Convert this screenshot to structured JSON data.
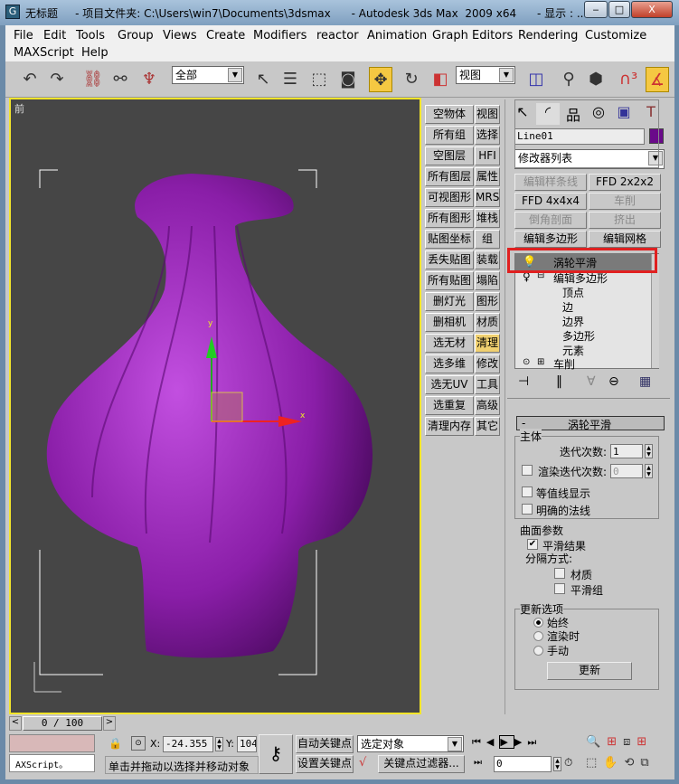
{
  "titlebar": {
    "text": "无标题     - 项目文件夹: C:\\Users\\win7\\Documents\\3dsmax      - Autodesk 3ds Max  2009 x64      - 显示 : ...",
    "app_icon": "3dsmax-logo-icon"
  },
  "menu": [
    "File",
    "Edit",
    "Tools",
    "Group",
    "Views",
    "Create",
    "Modifiers",
    "reactor",
    "Animation",
    "Graph Editors",
    "Rendering",
    "Customize",
    "MAXScript",
    "Help"
  ],
  "toolbar": {
    "selection_filter": "全部",
    "ref_coord": "视图"
  },
  "viewport": {
    "label": "前",
    "axis_y": "y",
    "axis_x": "x",
    "object_color": "#8a1ea8"
  },
  "left_buttons": [
    [
      "空物体",
      "视图"
    ],
    [
      "所有组",
      "选择"
    ],
    [
      "空图层",
      "HFI"
    ],
    [
      "所有图层",
      "属性"
    ],
    [
      "可视图形",
      "MRS"
    ],
    [
      "所有图形",
      "堆栈"
    ],
    [
      "贴图坐标",
      "组"
    ],
    [
      "丢失贴图",
      "装载"
    ],
    [
      "所有贴图",
      "塌陷"
    ],
    [
      "删灯光",
      "图形"
    ],
    [
      "删相机",
      "材质"
    ],
    [
      "选无材",
      "清理"
    ],
    [
      "选多维",
      "修改"
    ],
    [
      "选无UV",
      "工具"
    ],
    [
      "选重复",
      "高级"
    ],
    [
      "清理内存",
      "其它"
    ]
  ],
  "command_panel": {
    "object_name": "Line01",
    "object_color": "#6a0a8a",
    "modifier_list": "修改器列表",
    "modifier_buttons": [
      {
        "label": "编辑样条线",
        "enabled": false
      },
      {
        "label": "FFD 2x2x2",
        "enabled": true
      },
      {
        "label": "FFD 4x4x4",
        "enabled": true
      },
      {
        "label": "车削",
        "enabled": false
      },
      {
        "label": "倒角剖面",
        "enabled": false
      },
      {
        "label": "挤出",
        "enabled": false
      },
      {
        "label": "编辑多边形",
        "enabled": true
      },
      {
        "label": "编辑网格",
        "enabled": true
      }
    ],
    "stack": {
      "selected": "涡轮平滑",
      "item2": "编辑多边形",
      "subitems": [
        "顶点",
        "边",
        "边界",
        "多边形",
        "元素"
      ],
      "item3": "车削"
    },
    "rollout": {
      "title": "涡轮平滑",
      "collapse": "-",
      "main_group": "主体",
      "iterations_label": "迭代次数:",
      "iterations": "1",
      "render_iters_label": "渲染迭代次数:",
      "render_iters": "0",
      "render_iters_checked": false,
      "isoline": "等值线显示",
      "isoline_checked": false,
      "explicit_normals": "明确的法线",
      "explicit_checked": false,
      "surface_group": "曲面参数",
      "smooth_result": "平滑结果",
      "smooth_checked": true,
      "separate_by": "分隔方式:",
      "materials": "材质",
      "materials_checked": false,
      "smoothing_groups": "平滑组",
      "sg_checked": false,
      "update_group": "更新选项",
      "always": "始终",
      "when_rendering": "渲染时",
      "manually": "手动",
      "selected_update": "始终",
      "update_button": "更新"
    }
  },
  "timeline": {
    "frame": "0 / 100"
  },
  "status": {
    "maxscript": "AXScript。",
    "x_label": "X:",
    "x_value": "-24.355",
    "y_label": "Y:",
    "y_value": "104",
    "prompt": "单击并拖动以选择并移动对象",
    "auto_key": "自动关键点",
    "set_key": "设置关键点",
    "key_mode": "选定对象",
    "key_filters": "关键点过滤器...",
    "current_frame": "0"
  }
}
